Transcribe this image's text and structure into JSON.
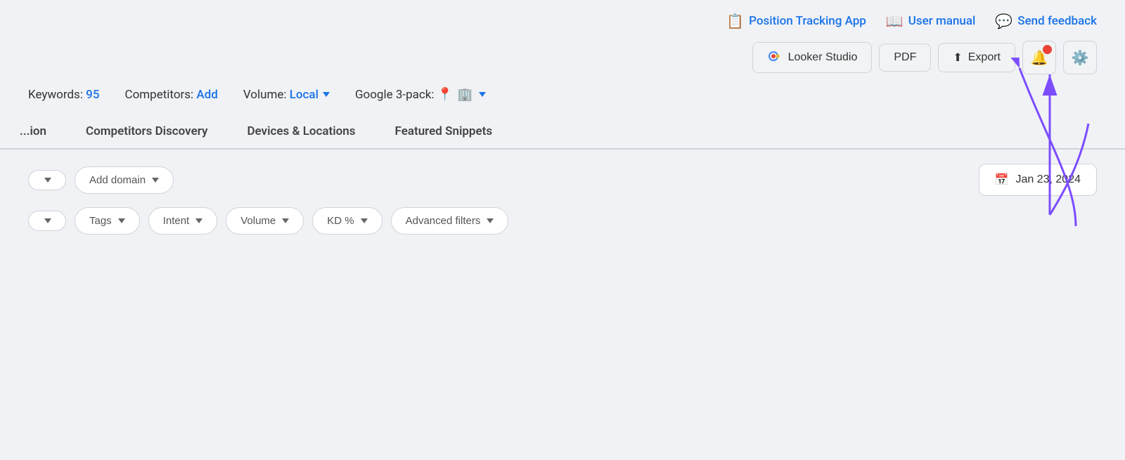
{
  "top_links": [
    {
      "id": "position-tracking",
      "label": "Position Tracking App",
      "icon": "📋"
    },
    {
      "id": "user-manual",
      "label": "User manual",
      "icon": "📖"
    },
    {
      "id": "send-feedback",
      "label": "Send feedback",
      "icon": "💬"
    }
  ],
  "toolbar": {
    "looker_label": "Looker Studio",
    "pdf_label": "PDF",
    "export_label": "Export"
  },
  "stats": {
    "keywords_label": "Keywords:",
    "keywords_value": "95",
    "competitors_label": "Competitors:",
    "competitors_value": "Add",
    "volume_label": "Volume:",
    "volume_value": "Local",
    "google_pack_label": "Google 3-pack:"
  },
  "tabs": [
    {
      "id": "overview",
      "label": "...ion",
      "active": false
    },
    {
      "id": "competitors",
      "label": "Competitors Discovery",
      "active": false
    },
    {
      "id": "devices",
      "label": "Devices & Locations",
      "active": false
    },
    {
      "id": "snippets",
      "label": "Featured Snippets",
      "active": false
    }
  ],
  "filters_row1": {
    "chevron_btn_label": "",
    "add_domain_label": "Add domain",
    "date_label": "Jan 23, 2024"
  },
  "filters_row2": {
    "chevron_btn_label": "",
    "tags_label": "Tags",
    "intent_label": "Intent",
    "volume_label": "Volume",
    "kd_label": "KD %",
    "advanced_label": "Advanced filters"
  }
}
